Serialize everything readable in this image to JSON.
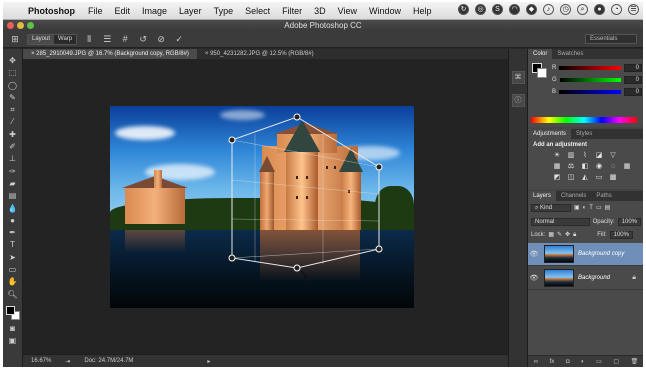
{
  "menubar": {
    "apple": "",
    "app_name": "Photoshop",
    "items": [
      "File",
      "Edit",
      "Image",
      "Layer",
      "Type",
      "Select",
      "Filter",
      "3D",
      "View",
      "Window",
      "Help"
    ],
    "status_icons": [
      "sync-icon",
      "creative-cloud-icon",
      "skype-icon",
      "wifi-icon",
      "dropbox-icon",
      "sound-icon",
      "clock-icon",
      "spotlight-icon",
      "user-icon",
      "time-machine-icon",
      "notification-icon"
    ]
  },
  "window": {
    "title": "Adobe Photoshop CC"
  },
  "options_bar": {
    "modes": [
      "Layout",
      "Warp"
    ],
    "workspace": "Essentials"
  },
  "tabs": [
    {
      "label": "285_2910049.JPG @ 16.7% (Background copy, RGB/8#)",
      "active": true
    },
    {
      "label": "950_4231282.JPG @ 12.5% (RGB/8#)",
      "active": false
    }
  ],
  "statusbar": {
    "zoom": "16.67%",
    "doc": "Doc: 24.7M/24.7M"
  },
  "color_panel": {
    "tabs": [
      "Color",
      "Swatches"
    ],
    "r": {
      "label": "R",
      "value": "0"
    },
    "g": {
      "label": "G",
      "value": "0"
    },
    "b": {
      "label": "B",
      "value": "0"
    }
  },
  "adjustments_panel": {
    "tabs": [
      "Adjustments",
      "Styles"
    ],
    "heading": "Add an adjustment"
  },
  "layers_panel": {
    "tabs": [
      "Layers",
      "Channels",
      "Paths"
    ],
    "kind": "Kind",
    "blend_mode": "Normal",
    "opacity_label": "Opacity:",
    "opacity": "100%",
    "lock_label": "Lock:",
    "fill_label": "Fill:",
    "fill": "100%",
    "layers": [
      {
        "name": "Background copy",
        "selected": true
      },
      {
        "name": "Background",
        "selected": false
      }
    ]
  },
  "colors": {
    "accent_selected_layer": "#6f8fb8",
    "ui_dark": "#282828"
  }
}
